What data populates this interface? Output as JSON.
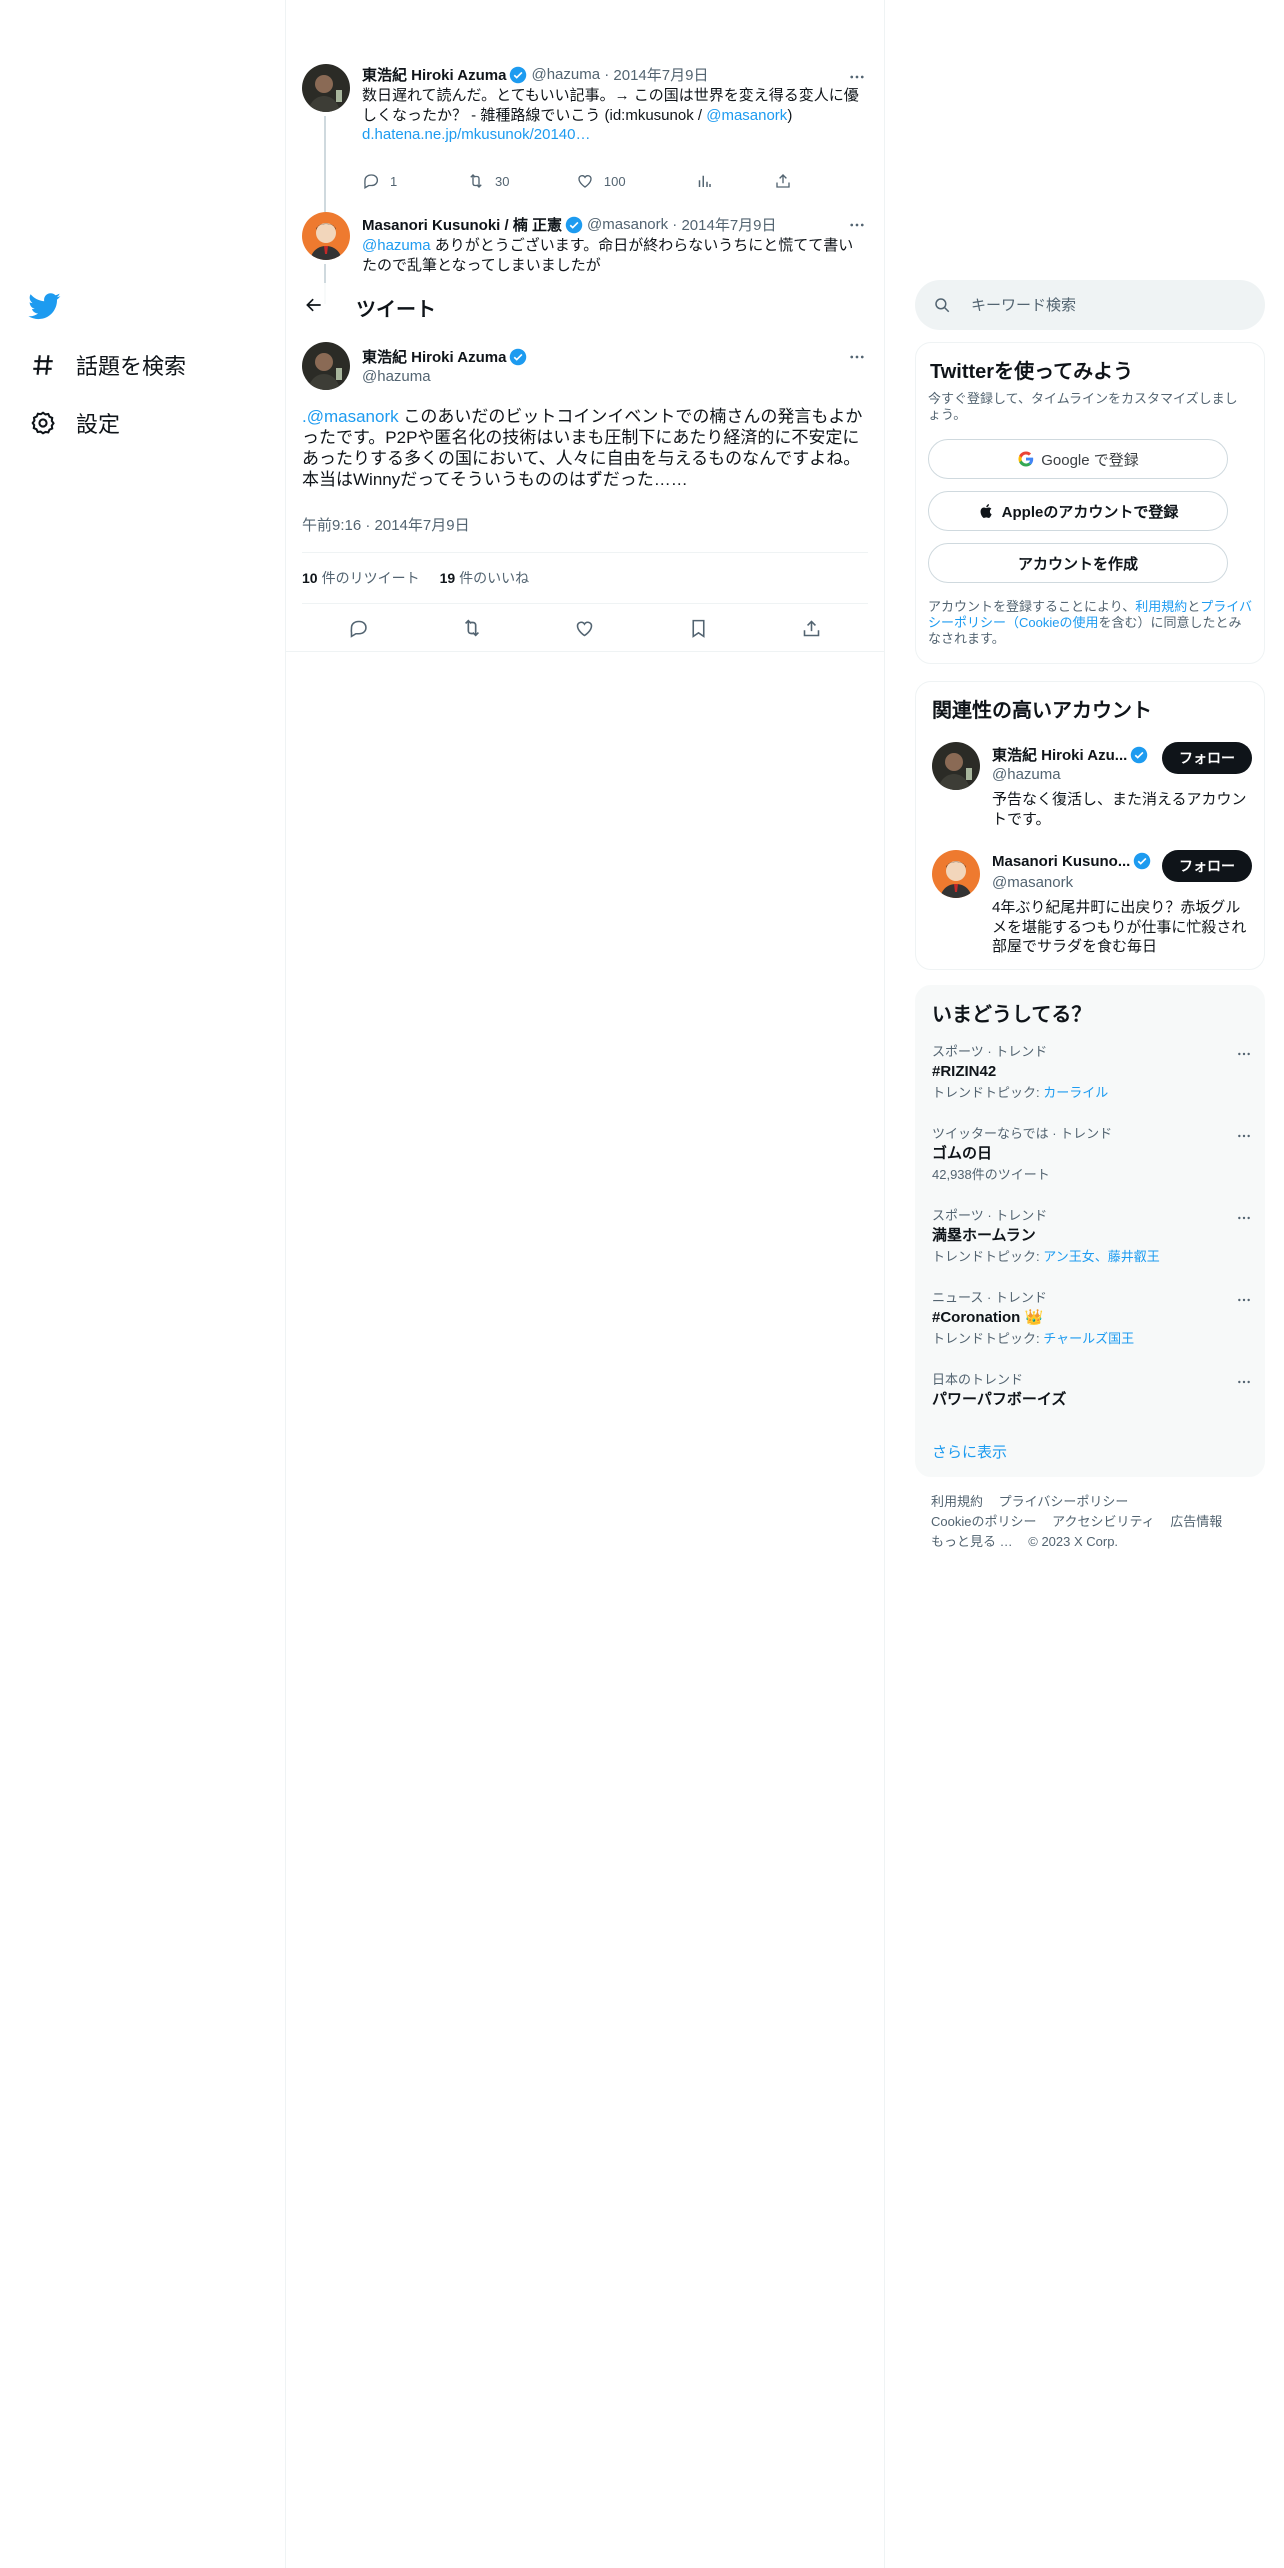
{
  "nav": {
    "explore_label": "話題を検索",
    "settings_label": "設定"
  },
  "thread": {
    "tweet1": {
      "name": "東浩紀 Hiroki Azuma",
      "handle": "@hazuma",
      "date": "2014年7月9日",
      "text_main": "数日遅れて読んだ。とてもいい記事。→ この国は世界を変え得る変人に優しくなったか？ - 雑種路線でいこう (id:mkusunok / ",
      "mention": "@masanork",
      "text_close": ")",
      "link": "d.hatena.ne.jp/mkusunok/20140…",
      "replies": "1",
      "retweets": "30",
      "likes": "100"
    },
    "tweet2": {
      "name": "Masanori Kusunoki / 楠 正憲",
      "handle": "@masanork",
      "date": "2014年7月9日",
      "mention": "@hazuma",
      "text": " ありがとうございます。命日が終わらないうちにと慌てて書いたので乱筆となってしまいましたが"
    }
  },
  "header": {
    "title": "ツイート"
  },
  "focus": {
    "name": "東浩紀 Hiroki Azuma",
    "handle": "@hazuma",
    "mention": ".@masanork",
    "text": " このあいだのビットコインイベントでの楠さんの発言もよかったです。P2Pや匿名化の技術はいまも圧制下にあたり経済的に不安定にあったりする多くの国において、人々に自由を与えるものなんですよね。本当はWinnyだってそういうもののはずだった……",
    "time": "午前9:16 · 2014年7月9日",
    "retweet_count": "10",
    "retweet_label": "件のリツイート",
    "like_count": "19",
    "like_label": "件のいいね"
  },
  "search": {
    "placeholder": "キーワード検索"
  },
  "signup": {
    "title": "Twitterを使ってみよう",
    "subtitle": "今すぐ登録して、タイムラインをカスタマイズしましょう。",
    "google_label": "Google で登録",
    "apple_label": "Appleのアカウントで登録",
    "create_label": "アカウントを作成",
    "legal_pre": "アカウントを登録することにより、",
    "legal_terms": "利用規約",
    "legal_and": "と",
    "legal_privacy": "プライバシーポリシー",
    "legal_cookie": "（Cookieの使用",
    "legal_post": "を含む）に同意したとみなされます。"
  },
  "related": {
    "title": "関連性の高いアカウント",
    "accounts": [
      {
        "name": "東浩紀 Hiroki Azu...",
        "handle": "@hazuma",
        "bio": "予告なく復活し、また消えるアカウントです。",
        "follow": "フォロー"
      },
      {
        "name": "Masanori Kusuno...",
        "handle": "@masanork",
        "bio": "4年ぶり紀尾井町に出戻り？赤坂グルメを堪能するつもりが仕事に忙殺され部屋でサラダを食む毎日",
        "follow": "フォロー"
      }
    ]
  },
  "trends": {
    "title": "いまどうしてる？",
    "items": [
      {
        "category": "スポーツ · トレンド",
        "name": "#RIZIN42",
        "sub_label": "トレンドトピック: ",
        "sub_link": "カーライル"
      },
      {
        "category": "ツイッターならでは · トレンド",
        "name": "ゴムの日",
        "sub_label": "42,938件のツイート",
        "sub_link": ""
      },
      {
        "category": "スポーツ · トレンド",
        "name": "満塁ホームラン",
        "sub_label": "トレンドトピック: ",
        "sub_link": "アン王女、藤井叡王"
      },
      {
        "category": "ニュース · トレンド",
        "name": "#Coronation 👑",
        "sub_label": "トレンドトピック: ",
        "sub_link": "チャールズ国王"
      },
      {
        "category": "日本のトレンド",
        "name": "パワーパフボーイズ",
        "sub_label": "",
        "sub_link": ""
      }
    ],
    "show_more": "さらに表示"
  },
  "footer": {
    "terms": "利用規約",
    "privacy": "プライバシーポリシー",
    "cookie": "Cookieのポリシー",
    "accessibility": "アクセシビリティ",
    "ads": "広告情報",
    "more": "もっと見る …",
    "copyright": "© 2023 X Corp."
  },
  "colors": {
    "accent": "#1d9bf0",
    "text": "#0f1419",
    "muted": "#536471",
    "border": "#eff3f4"
  }
}
